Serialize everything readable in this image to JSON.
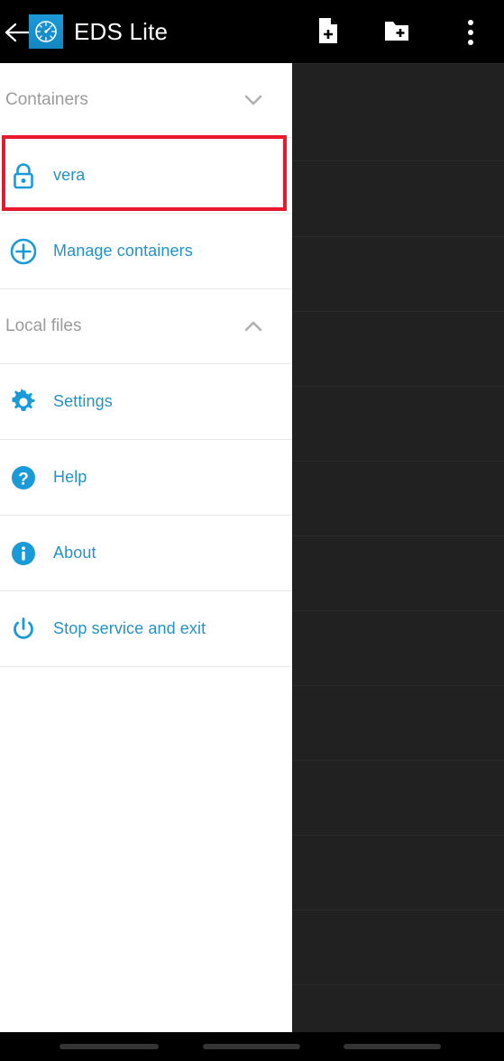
{
  "app": {
    "title": "EDS Lite",
    "icon": "compass-clock-icon",
    "accent_blue": "#1b9ad8",
    "text_blue": "#2592c6",
    "highlight_red": "#e8192c",
    "appbar_bg": "#000000",
    "drawer_bg": "#ffffff",
    "scrim_bg": "#212121"
  },
  "appbar": {
    "back_icon": "back-arrow-icon",
    "actions": [
      {
        "name": "new-file-button",
        "icon": "file-plus-icon"
      },
      {
        "name": "new-folder-button",
        "icon": "folder-plus-icon"
      },
      {
        "name": "overflow-menu-button",
        "icon": "more-vertical-icon"
      }
    ]
  },
  "drawer": {
    "sections": [
      {
        "label": "Containers",
        "chevron": "chevron-down-icon",
        "expanded": true,
        "items": [
          {
            "label": "vera",
            "icon": "lock-icon",
            "highlighted": true
          },
          {
            "label": "Manage containers",
            "icon": "plus-circle-icon",
            "highlighted": false
          }
        ]
      },
      {
        "label": "Local files",
        "chevron": "chevron-up-icon",
        "expanded": false,
        "items": []
      }
    ],
    "menu": [
      {
        "label": "Settings",
        "icon": "gear-icon"
      },
      {
        "label": "Help",
        "icon": "question-circle-icon"
      },
      {
        "label": "About",
        "icon": "info-circle-icon"
      },
      {
        "label": "Stop service and exit",
        "icon": "power-icon"
      }
    ]
  },
  "system_nav": {
    "back": "back-pill",
    "home": "home-pill",
    "recents": "recents-pill"
  }
}
